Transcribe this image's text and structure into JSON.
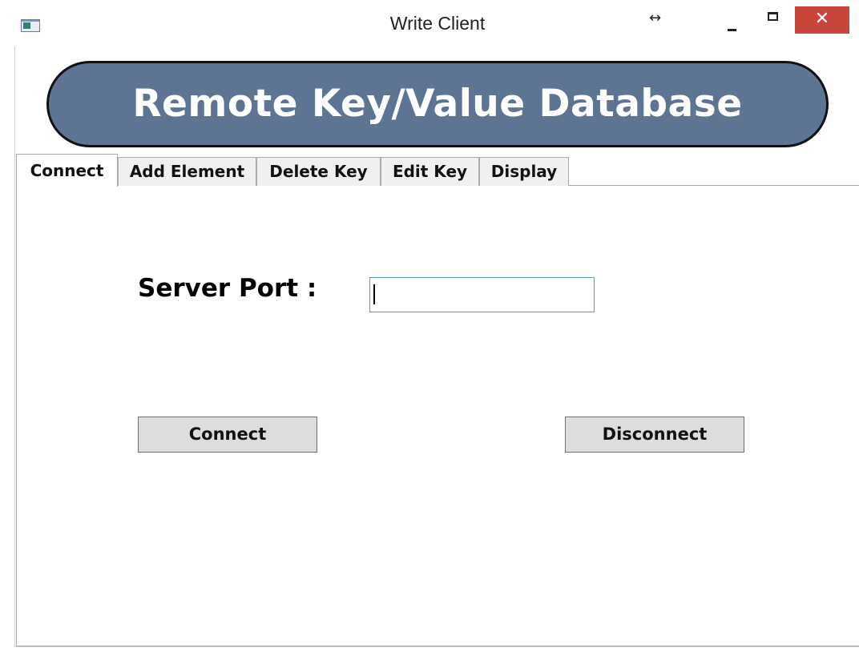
{
  "window": {
    "title": "Write Client",
    "resize_glyph": "↔",
    "close_glyph": "✕"
  },
  "banner": {
    "title": "Remote Key/Value Database"
  },
  "tabs": [
    {
      "label": "Connect",
      "active": true
    },
    {
      "label": "Add Element",
      "active": false
    },
    {
      "label": "Delete Key",
      "active": false
    },
    {
      "label": "Edit Key",
      "active": false
    },
    {
      "label": "Display",
      "active": false
    }
  ],
  "connect_panel": {
    "port_label": "Server Port :",
    "port_value": "",
    "connect_label": "Connect",
    "disconnect_label": "Disconnect"
  },
  "colors": {
    "banner_fill": "#5d7592",
    "close_button": "#c9463d",
    "input_focus_border": "#5b9bd5",
    "button_fill": "#dddddd"
  },
  "icons": [
    "app-icon",
    "resize-icon",
    "minimize-icon",
    "maximize-icon",
    "close-icon"
  ]
}
